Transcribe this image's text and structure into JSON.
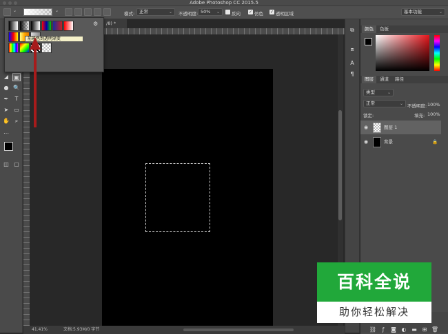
{
  "window": {
    "title": "Adobe Photoshop CC 2015.5"
  },
  "options_bar": {
    "mode_label": "模式:",
    "mode_value": "正常",
    "opacity_label": "不透明度:",
    "opacity_value": "50%",
    "reverse_label": "反向",
    "dither_label": "仿色",
    "transparency_label": "透明区域",
    "workspace_value": "基本功能"
  },
  "gradient_picker": {
    "tooltip": "前景色到透明渐变"
  },
  "document": {
    "tab_label": "/8) *",
    "zoom": "41.41%",
    "doc_info": "文档:5.93M/0 字节"
  },
  "color_panel": {
    "tab_color": "颜色",
    "tab_swatches": "色板",
    "accent_red": "#e5141a"
  },
  "layers_panel": {
    "tab_layers": "图层",
    "tab_channels": "通道",
    "tab_paths": "路径",
    "filter_kind": "类型",
    "blend_mode": "正常",
    "opacity_label": "不透明度:",
    "opacity_value": "100%",
    "lock_label": "锁定:",
    "fill_label": "填充:",
    "fill_value": "100%",
    "layers": [
      {
        "name": "图层 1"
      },
      {
        "name": "背景"
      }
    ]
  },
  "watermark": {
    "title": "百科全说",
    "subtitle": "助你轻松解决",
    "brand_color": "#21a83a"
  }
}
